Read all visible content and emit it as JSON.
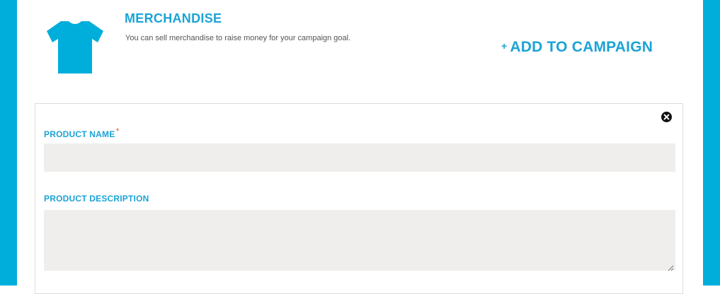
{
  "section": {
    "title": "MERCHANDISE",
    "description": "You can sell merchandise to raise money for your campaign goal.",
    "add_label": "ADD TO CAMPAIGN",
    "add_prefix": "+",
    "icon": "tshirt-icon"
  },
  "form": {
    "product_name_label": "PRODUCT NAME",
    "required_marker": "*",
    "product_name_value": "",
    "product_description_label": "PRODUCT DESCRIPTION",
    "product_description_value": "",
    "close_icon": "close-icon"
  },
  "colors": {
    "accent": "#1ba3d6",
    "frame": "#00aedb",
    "input_bg": "#efeeec",
    "required": "#e05b35"
  }
}
